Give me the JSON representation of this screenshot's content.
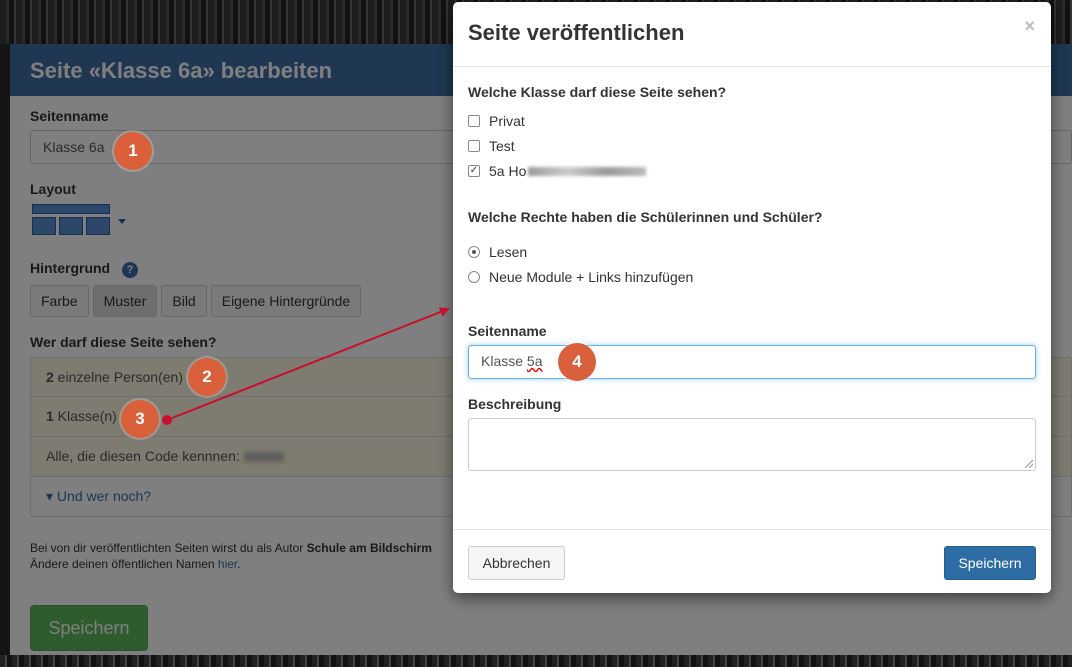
{
  "editor": {
    "title": "Seite «Klasse 6a» bearbeiten",
    "page_name_label": "Seitenname",
    "page_name_value": "Klasse 6a",
    "layout_label": "Layout",
    "background_label": "Hintergrund",
    "background_buttons": [
      "Farbe",
      "Muster",
      "Bild",
      "Eigene Hintergründe"
    ],
    "who_label": "Wer darf diese Seite sehen?",
    "who_rows": [
      {
        "count": "2",
        "text": " einzelne Person(en)"
      },
      {
        "count": "1",
        "text": " Klasse(n)"
      },
      {
        "count": "",
        "text": "Alle, die diesen Code kennnen: "
      }
    ],
    "more_link": "Und wer noch?",
    "author_note_1": "Bei von dir veröffentlichten Seiten wirst du als Autor ",
    "author_name": "Schule am Bildschirm",
    "author_note_2": "Ändere deinen öffentlichen Namen ",
    "author_link": "hier",
    "save_label": "Speichern"
  },
  "callouts": [
    "1",
    "2",
    "3",
    "4"
  ],
  "modal": {
    "title": "Seite veröffentlichen",
    "close": "×",
    "class_question": "Welche Klasse darf diese Seite sehen?",
    "class_options": [
      {
        "label": "Privat",
        "checked": false
      },
      {
        "label": "Test",
        "checked": false
      },
      {
        "label": "5a Ho",
        "checked": true
      }
    ],
    "rights_question": "Welche Rechte haben die Schülerinnen und Schüler?",
    "rights_options": [
      {
        "label": "Lesen",
        "selected": true
      },
      {
        "label": "Neue Module + Links hinzufügen",
        "selected": false
      }
    ],
    "page_name_label": "Seitenname",
    "page_name_value_1": "Klasse ",
    "page_name_value_2": "5a",
    "description_label": "Beschreibung",
    "cancel_label": "Abbrechen",
    "save_label": "Speichern"
  },
  "colors": {
    "header_blue": "#3f6fa6",
    "callout_orange": "#d9603b",
    "save_green": "#5cb85c",
    "primary_blue": "#2e6da4",
    "arrow_red": "#c8102e"
  }
}
